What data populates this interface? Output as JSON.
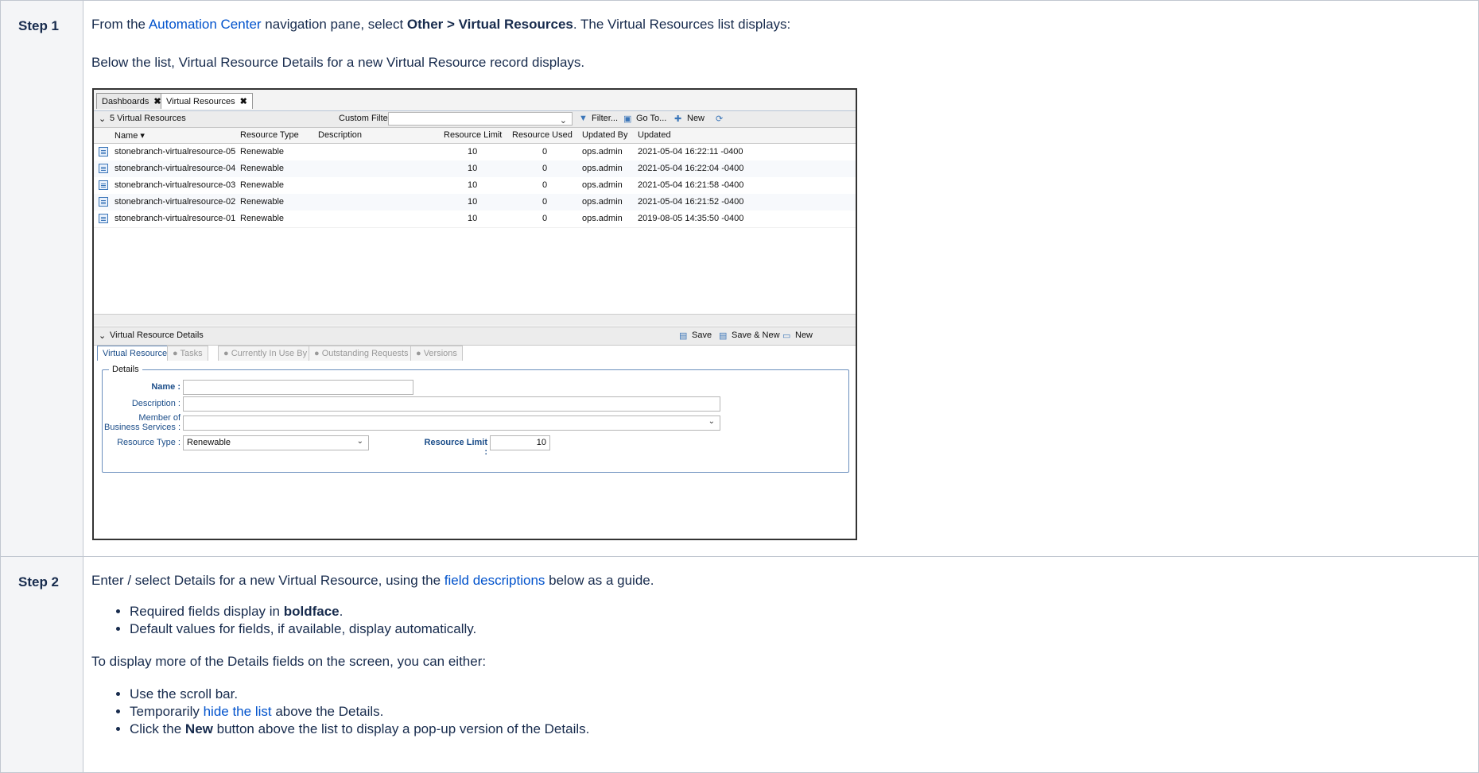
{
  "steps": [
    {
      "label": "Step 1",
      "p1": {
        "pre": "From the ",
        "link": "Automation Center",
        "mid": " navigation pane, select ",
        "bold": "Other > Virtual Resources",
        "post": ". The Virtual Resources list displays:"
      },
      "p2": "Below the list, Virtual Resource Details for a new Virtual Resource record displays."
    },
    {
      "label": "Step 2",
      "p1": {
        "pre": "Enter / select Details for a new Virtual Resource, using the ",
        "link": "field descriptions",
        "post": " below as a guide."
      },
      "bullets1": [
        {
          "pre": "Required fields display in ",
          "bold": "boldface",
          "post": "."
        },
        {
          "text": "Default values for fields, if available, display automatically."
        }
      ],
      "p2": "To display more of the Details fields on the screen, you can either:",
      "bullets2": [
        {
          "text": "Use the scroll bar."
        },
        {
          "pre": "Temporarily ",
          "link": "hide the list",
          "post": " above the Details."
        },
        {
          "pre": "Click the ",
          "bold": "New",
          "post": " button above the list to display a pop-up version of the Details."
        }
      ]
    }
  ],
  "app": {
    "tabs": [
      {
        "label": "Dashboards",
        "close": "✖"
      },
      {
        "label": "Virtual Resources",
        "close": "✖"
      }
    ],
    "list_title": "5 Virtual Resources",
    "custom_filter_label": "Custom Filter",
    "toolbar": {
      "filter": "Filter...",
      "goto": "Go To...",
      "new": "New"
    },
    "columns": [
      "Name",
      "Resource Type",
      "Description",
      "Resource Limit",
      "Resource Used",
      "Updated By",
      "Updated"
    ],
    "rows": [
      [
        "stonebranch-virtualresource-05",
        "Renewable",
        "",
        "10",
        "0",
        "ops.admin",
        "2021-05-04 16:22:11 -0400"
      ],
      [
        "stonebranch-virtualresource-04",
        "Renewable",
        "",
        "10",
        "0",
        "ops.admin",
        "2021-05-04 16:22:04 -0400"
      ],
      [
        "stonebranch-virtualresource-03",
        "Renewable",
        "",
        "10",
        "0",
        "ops.admin",
        "2021-05-04 16:21:58 -0400"
      ],
      [
        "stonebranch-virtualresource-02",
        "Renewable",
        "",
        "10",
        "0",
        "ops.admin",
        "2021-05-04 16:21:52 -0400"
      ],
      [
        "stonebranch-virtualresource-01",
        "Renewable",
        "",
        "10",
        "0",
        "ops.admin",
        "2019-08-05 14:35:50 -0400"
      ]
    ],
    "details_title": "Virtual Resource Details",
    "details_buttons": {
      "save": "Save",
      "save_new": "Save & New",
      "new": "New"
    },
    "detail_tabs": [
      "Virtual Resource",
      "Tasks",
      "Currently In Use By",
      "Outstanding Requests",
      "Versions"
    ],
    "fieldset_legend": "Details",
    "fields": {
      "name_label": "Name :",
      "description_label": "Description :",
      "member_label_1": "Member of",
      "member_label_2": "Business Services :",
      "resource_type_label": "Resource Type :",
      "resource_type_value": "Renewable",
      "resource_limit_label": "Resource Limit :",
      "resource_limit_value": "10"
    }
  }
}
